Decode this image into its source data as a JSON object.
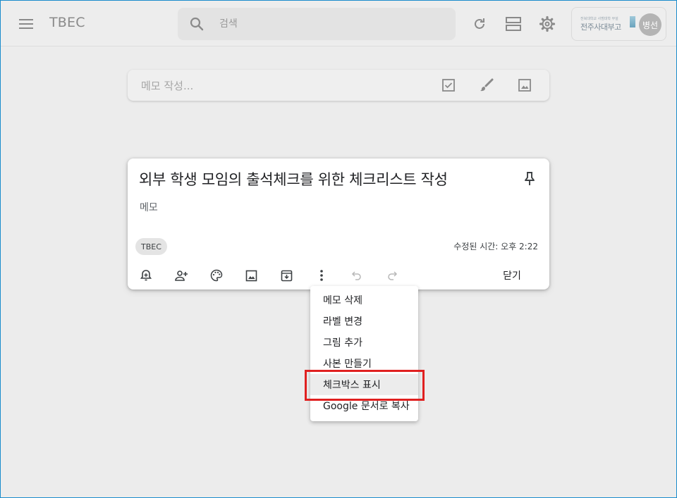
{
  "header": {
    "app_title": "TBEC",
    "search_placeholder": "검색",
    "org_logo_text": "전주사대부고",
    "org_logo_subtext": "전북대학교 사범대학 부설",
    "avatar_text": "병선"
  },
  "take_note": {
    "placeholder": "메모 작성..."
  },
  "note": {
    "title": "외부 학생 모임의 출석체크를 위한 체크리스트 작성",
    "body": "메모",
    "label_chip": "TBEC",
    "edited_time": "수정된 시간: 오후 2:22",
    "close_label": "닫기"
  },
  "more_menu": {
    "items": [
      "메모 삭제",
      "라벨 변경",
      "그림 추가",
      "사본 만들기",
      "체크박스 표시",
      "Google 문서로 복사"
    ],
    "hovered_index": 4
  },
  "colors": {
    "background": "#ececec",
    "highlight_border": "#e02020",
    "icon_gray": "#8a8a8a",
    "icon_dark": "#5f6368"
  },
  "icons": {
    "menu": "hamburger-menu-icon",
    "search": "search-icon",
    "refresh": "refresh-icon",
    "layout": "list-view-icon",
    "settings": "gear-icon",
    "pin": "pin-icon"
  }
}
